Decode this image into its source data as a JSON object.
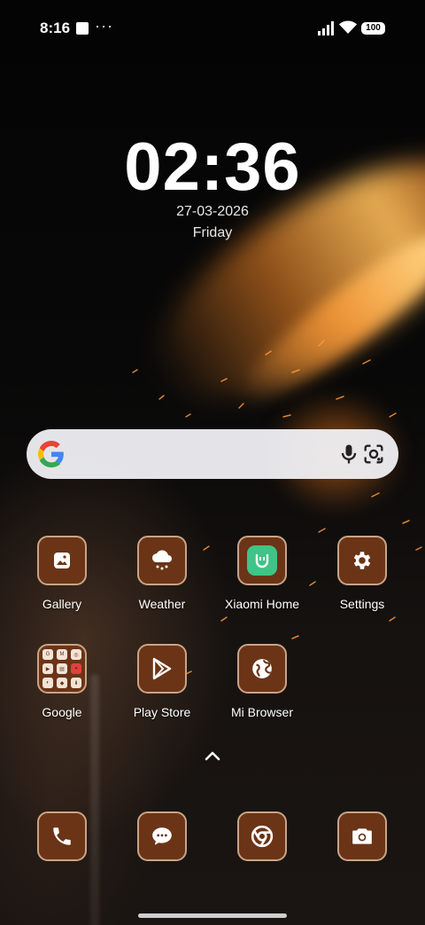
{
  "status_bar": {
    "time": "8:16",
    "overflow": "···",
    "battery": "100",
    "icons": [
      "notification-square-icon",
      "signal-icon",
      "wifi-icon",
      "battery-icon"
    ]
  },
  "clock_widget": {
    "time": "02:36",
    "date": "27-03-2026",
    "day": "Friday"
  },
  "search_bar": {
    "icons": [
      "google-logo-icon",
      "microphone-icon",
      "google-lens-icon"
    ]
  },
  "apps_row1": [
    {
      "label": "Gallery",
      "icon": "gallery-icon"
    },
    {
      "label": "Weather",
      "icon": "weather-icon"
    },
    {
      "label": "Xiaomi Home",
      "icon": "xiaomi-home-icon"
    },
    {
      "label": "Settings",
      "icon": "gear-icon"
    }
  ],
  "apps_row2": [
    {
      "label": "Google",
      "icon": "folder-icon"
    },
    {
      "label": "Play Store",
      "icon": "play-store-icon"
    },
    {
      "label": "Mi Browser",
      "icon": "globe-icon"
    }
  ],
  "folder_contents": [
    "G",
    "M",
    "◎",
    "▶",
    "▤",
    "●",
    "◐",
    "◆",
    "⬇"
  ],
  "dock": [
    {
      "icon": "phone-icon"
    },
    {
      "icon": "messages-icon"
    },
    {
      "icon": "chrome-icon"
    },
    {
      "icon": "camera-icon"
    }
  ],
  "colors": {
    "tile": "#6b3417",
    "tile_border": "#c9a486",
    "accent_green": "#3ec487"
  }
}
